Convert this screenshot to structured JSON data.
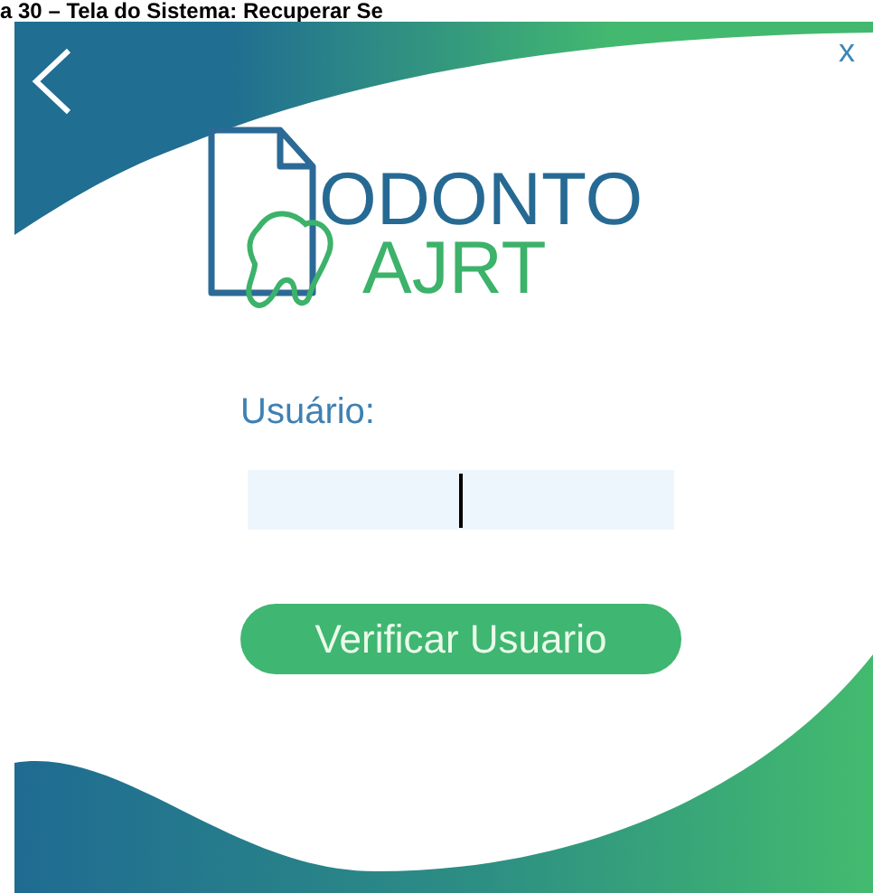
{
  "caption": "a 30 – Tela do Sistema: Recuperar Se",
  "window": {
    "close": "x"
  },
  "logo": {
    "line1": "ODONTO",
    "line2": "AJRT"
  },
  "form": {
    "label": "Usuário:",
    "button": "Verificar Usuario"
  }
}
